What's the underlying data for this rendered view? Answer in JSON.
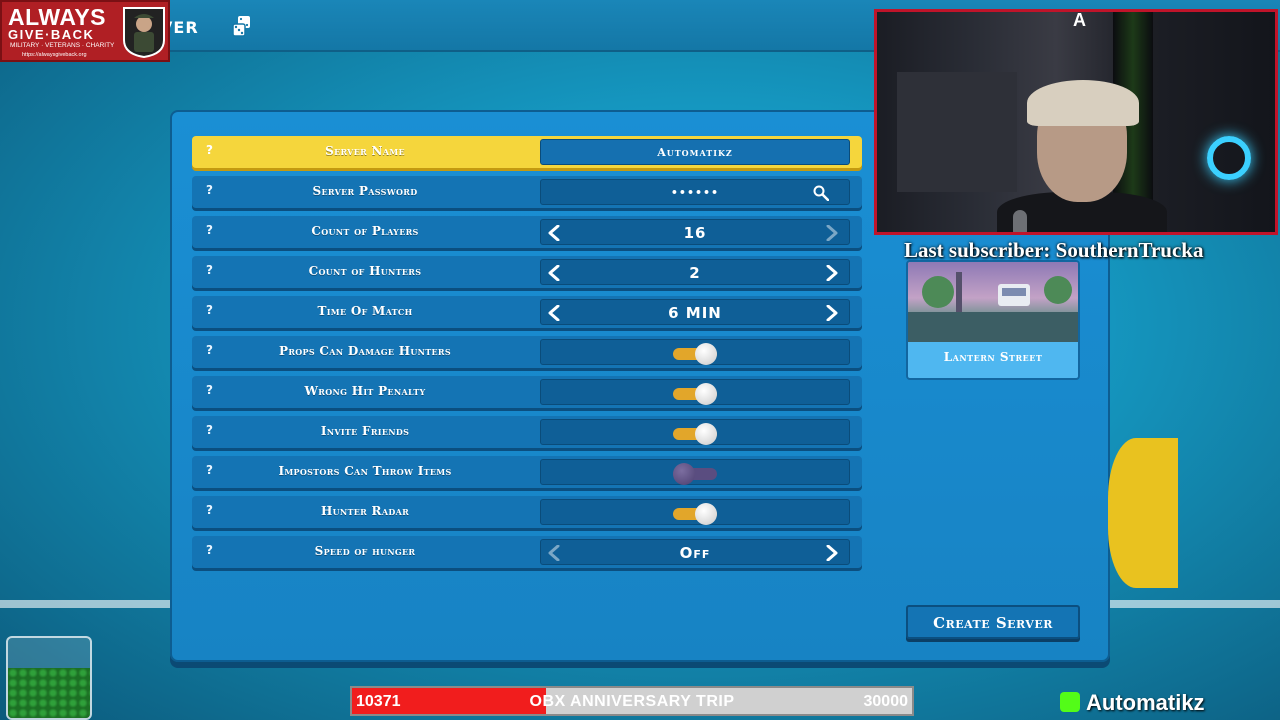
{
  "topbar": {
    "title": "VER"
  },
  "logo": {
    "line1": "ALWAYS",
    "line2": "GIVE·BACK",
    "line3": "MILITARY · VETERANS · CHARITY",
    "line4": "https://alwaysgiveback.org"
  },
  "settings": [
    {
      "label": "Server Name",
      "control": "text",
      "value": "Automatikz",
      "active": true
    },
    {
      "label": "Server Password",
      "control": "password",
      "value": "••••••"
    },
    {
      "label": "Count of Players",
      "control": "stepper",
      "value": "16",
      "left_enabled": true,
      "right_enabled": false
    },
    {
      "label": "Count of Hunters",
      "control": "stepper",
      "value": "2",
      "left_enabled": true,
      "right_enabled": true
    },
    {
      "label": "Time Of Match",
      "control": "stepper",
      "value": "6 MIN",
      "left_enabled": true,
      "right_enabled": true
    },
    {
      "label": "Props Can Damage Hunters",
      "control": "toggle",
      "on": true
    },
    {
      "label": "Wrong Hit Penalty",
      "control": "toggle",
      "on": true
    },
    {
      "label": "Invite Friends",
      "control": "toggle",
      "on": true
    },
    {
      "label": "Impostors Can Throw Items",
      "control": "toggle",
      "on": false
    },
    {
      "label": "Hunter Radar",
      "control": "toggle",
      "on": true
    },
    {
      "label": "Speed of hunger",
      "control": "stepper",
      "value": "Off",
      "left_enabled": false,
      "right_enabled": true
    }
  ],
  "help_glyph": "?",
  "map": {
    "name": "Lantern Street"
  },
  "create_button": "Create Server",
  "stream": {
    "cam_logo": "A",
    "last_subscriber": "Last subscriber: SouthernTrucka",
    "goal": {
      "current": "10371",
      "name": "OBX ANNIVERSARY TRIP",
      "target": "30000",
      "progress": 0.3457
    },
    "brand": "Automatikz"
  },
  "colors": {
    "active_row": "#f5d63c",
    "row": "#1474b4",
    "toggle_on": "#e2a62a",
    "toggle_off": "#5a4d80",
    "goal_fill": "#f11d1d",
    "cam_border": "#c0142a"
  },
  "icons": {
    "search": "search-icon",
    "left": "arrow-left-icon",
    "right": "arrow-right-icon",
    "dice": "dice-icon"
  }
}
